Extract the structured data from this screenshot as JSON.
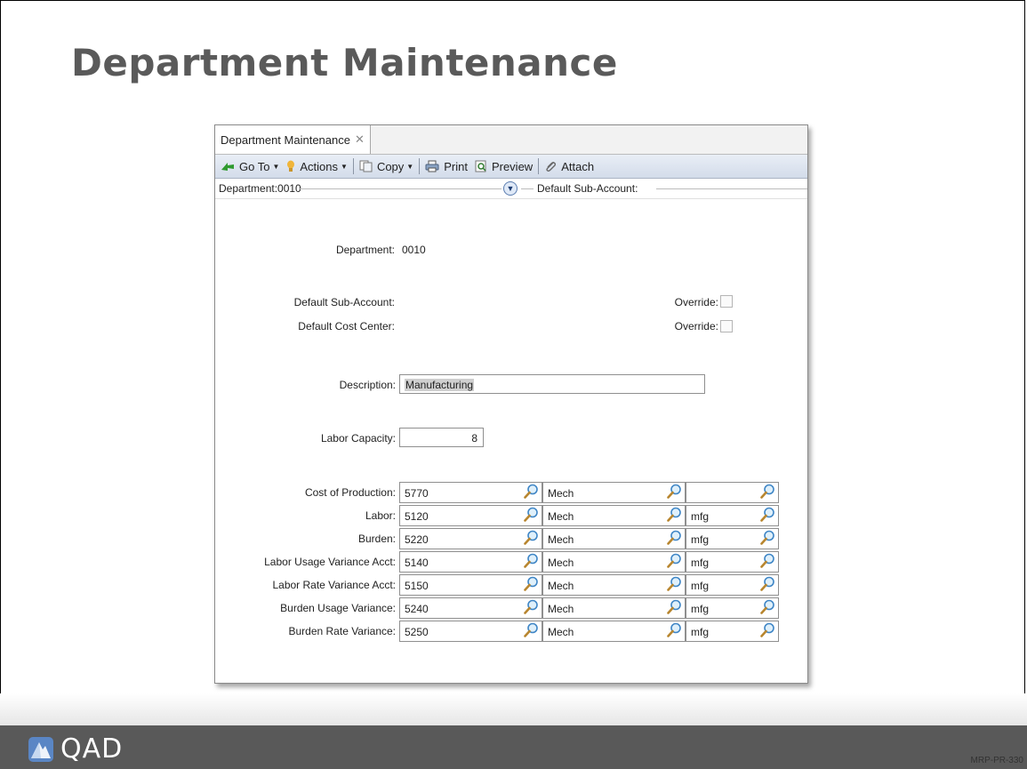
{
  "slide": {
    "title": "Department Maintenance",
    "page_code": "MRP-PR-330"
  },
  "footer": {
    "logo_text": "QAD",
    "logo_icon": "qad-logo-icon"
  },
  "window": {
    "tab_title": "Department Maintenance",
    "toolbar": {
      "goto": "Go To",
      "actions": "Actions",
      "copy": "Copy",
      "print": "Print",
      "preview": "Preview",
      "attach": "Attach"
    },
    "summary": {
      "left": "Department:0010",
      "right": "Default Sub-Account:"
    }
  },
  "form": {
    "department_label": "Department:",
    "department_value": "0010",
    "default_subaccount_label": "Default Sub-Account:",
    "default_costcenter_label": "Default Cost Center:",
    "override_label": "Override:",
    "description_label": "Description:",
    "description_value": "Manufacturing",
    "labor_capacity_label": "Labor Capacity:",
    "labor_capacity_value": "8",
    "accounts": [
      {
        "label": "Cost of Production:",
        "acct": "5770",
        "sub": "Mech",
        "cc": ""
      },
      {
        "label": "Labor:",
        "acct": "5120",
        "sub": "Mech",
        "cc": "mfg"
      },
      {
        "label": "Burden:",
        "acct": "5220",
        "sub": "Mech",
        "cc": "mfg"
      },
      {
        "label": "Labor Usage Variance Acct:",
        "acct": "5140",
        "sub": "Mech",
        "cc": "mfg"
      },
      {
        "label": "Labor Rate Variance Acct:",
        "acct": "5150",
        "sub": "Mech",
        "cc": "mfg"
      },
      {
        "label": "Burden Usage Variance:",
        "acct": "5240",
        "sub": "Mech",
        "cc": "mfg"
      },
      {
        "label": "Burden Rate Variance:",
        "acct": "5250",
        "sub": "Mech",
        "cc": "mfg"
      }
    ]
  },
  "colors": {
    "footer": "#595959",
    "title": "#5a5a5a",
    "toolbar": "#d3dcea"
  }
}
